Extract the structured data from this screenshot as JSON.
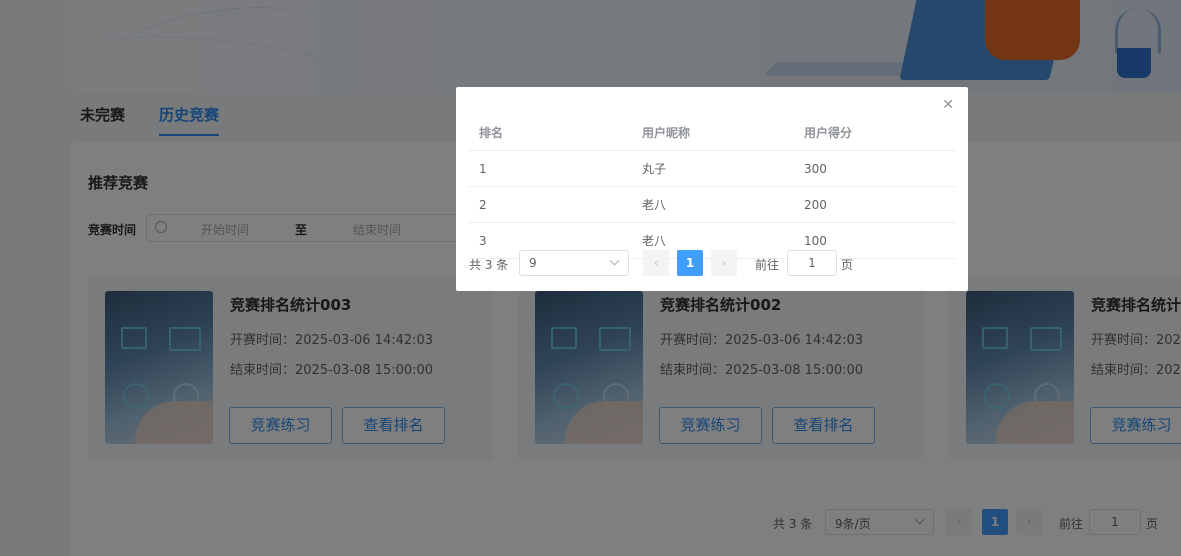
{
  "tabs": [
    {
      "label": "未完赛",
      "active": false
    },
    {
      "label": "历史竞赛",
      "active": true
    }
  ],
  "section_title": "推荐竞赛",
  "filter": {
    "label": "竞赛时间",
    "start_placeholder": "开始时间",
    "separator": "至",
    "end_placeholder": "结束时间"
  },
  "cards": [
    {
      "title": "竞赛排名统计003",
      "start": "开赛时间：2025-03-06 14:42:03",
      "end": "结束时间：2025-03-08 15:00:00",
      "practice_label": "竞赛练习",
      "rank_label": "查看排名"
    },
    {
      "title": "竞赛排名统计002",
      "start": "开赛时间：2025-03-06 14:42:03",
      "end": "结束时间：2025-03-08 15:00:00",
      "practice_label": "竞赛练习",
      "rank_label": "查看排名"
    },
    {
      "title": "竞赛排名统计",
      "start": "开赛时间：202",
      "end": "结束时间：202",
      "practice_label": "竞赛练习",
      "rank_label": ""
    }
  ],
  "pagination": {
    "total": "共 3 条",
    "page_size": "9条/页",
    "current_page": "1",
    "goto_label": "前往",
    "goto_value": "1",
    "goto_unit": "页"
  },
  "dialog": {
    "columns": [
      "排名",
      "用户昵称",
      "用户得分"
    ],
    "rows": [
      [
        "1",
        "丸子",
        "300"
      ],
      [
        "2",
        "老八",
        "200"
      ],
      [
        "3",
        "老八",
        "100"
      ]
    ],
    "pagination": {
      "total": "共 3 条",
      "page_size": "9",
      "current_page": "1",
      "goto_label": "前往",
      "goto_value": "1",
      "goto_unit": "页"
    }
  },
  "icons": {
    "close": "close-icon",
    "clock": "clock-icon",
    "chevron": "chevron-down-icon"
  },
  "colors": {
    "accent": "#409eff",
    "tab_active": "#2d8cf0"
  }
}
